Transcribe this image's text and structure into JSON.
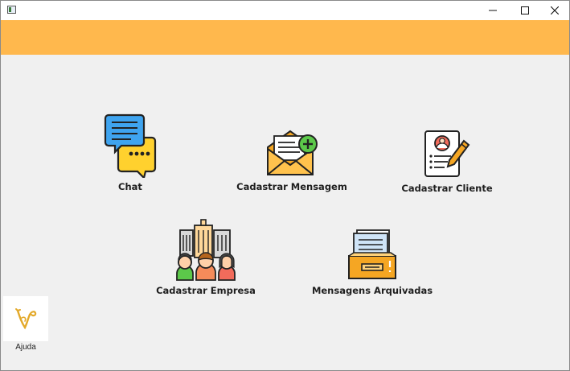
{
  "window": {
    "title": "",
    "controls": {
      "minimize": "minimize-icon",
      "maximize": "maximize-icon",
      "close": "close-icon"
    }
  },
  "colors": {
    "header_band": "#ffb84d",
    "background": "#f0f0f0"
  },
  "menu": [
    {
      "id": "chat",
      "label": "Chat",
      "icon": "chat-bubbles-icon"
    },
    {
      "id": "cadastrar-mensagem",
      "label": "Cadastrar Mensagem",
      "icon": "envelope-add-icon"
    },
    {
      "id": "cadastrar-cliente",
      "label": "Cadastrar Cliente",
      "icon": "client-form-icon"
    },
    {
      "id": "cadastrar-empresa",
      "label": "Cadastrar Empresa",
      "icon": "company-people-icon"
    },
    {
      "id": "mensagens-arquivadas",
      "label": "Mensagens Arquivadas",
      "icon": "archive-tray-icon"
    }
  ],
  "help": {
    "label": "Ajuda",
    "icon": "help-icon"
  }
}
